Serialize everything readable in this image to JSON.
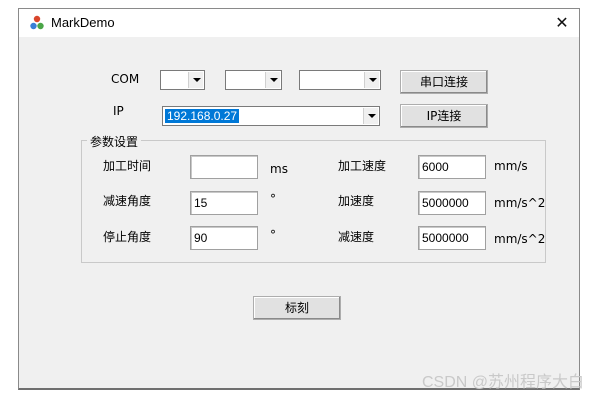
{
  "window": {
    "title": "MarkDemo",
    "close_glyph": "✕",
    "app_icon": "app-icon"
  },
  "connection": {
    "com_label": "COM",
    "com_selects": [
      "",
      "",
      ""
    ],
    "ip_label": "IP",
    "ip_value": "192.168.0.27",
    "serial_connect_label": "串口连接",
    "ip_connect_label": "IP连接"
  },
  "params": {
    "group_title": "参数设置",
    "process_time": {
      "label": "加工时间",
      "value": "",
      "unit": "ms"
    },
    "decel_angle": {
      "label": "减速角度",
      "value": "15",
      "unit": "°"
    },
    "stop_angle": {
      "label": "停止角度",
      "value": "90",
      "unit": "°"
    },
    "process_speed": {
      "label": "加工速度",
      "value": "6000",
      "unit": "mm/s"
    },
    "acceleration": {
      "label": "加速度",
      "value": "5000000",
      "unit": "mm/s^2"
    },
    "deceleration": {
      "label": "减速度",
      "value": "5000000",
      "unit": "mm/s^2"
    }
  },
  "actions": {
    "mark_label": "标刻"
  },
  "watermark": "CSDN @苏州程序大白",
  "colors": {
    "selection": "#0078d7",
    "window_bg": "#f0f0f0"
  }
}
